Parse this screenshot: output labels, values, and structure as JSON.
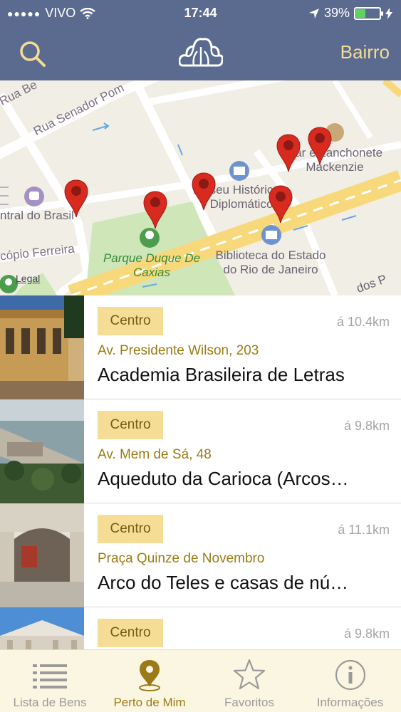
{
  "status_bar": {
    "carrier": "VIVO",
    "time": "17:44",
    "battery": "39%"
  },
  "nav": {
    "right_button": "Bairro",
    "left_icon": "search-icon",
    "center_icon": "cloud-logo-icon"
  },
  "map": {
    "labels": {
      "street1": "Rua Senador Pom",
      "street2": "Rua Be",
      "street3": "cópio Ferreira",
      "station": "ntral do Brasil",
      "museum": "Museu Histórico e Diplomático",
      "cafe": "Bar e Lanchonete Mackenzie",
      "park": "Parque Duque De Caxias",
      "library": "Biblioteca do Estado do Rio de Janeiro",
      "edge": "dos P"
    },
    "legal": "Legal"
  },
  "colors": {
    "header": "#5b6a8f",
    "badge_bg": "#f6dd95",
    "accent": "#9b7a18",
    "pin": "#d92a20"
  },
  "items": [
    {
      "badge": "Centro",
      "distance": "á 10.4km",
      "address": "Av. Presidente Wilson, 203",
      "title": "Academia Brasileira de Letras"
    },
    {
      "badge": "Centro",
      "distance": "á 9.8km",
      "address": "Av. Mem de Sá, 48",
      "title": "Aqueduto da Carioca (Arcos…"
    },
    {
      "badge": "Centro",
      "distance": "á 11.1km",
      "address": "Praça Quinze de Novembro",
      "title": "Arco do Teles e casas de nú…"
    },
    {
      "badge": "Centro",
      "distance": "á 9.8km",
      "address": "",
      "title": ""
    }
  ],
  "tabs": [
    {
      "label": "Lista de Bens",
      "icon": "list-icon",
      "active": false
    },
    {
      "label": "Perto de Mim",
      "icon": "location-pin-icon",
      "active": true
    },
    {
      "label": "Favoritos",
      "icon": "star-icon",
      "active": false
    },
    {
      "label": "Informações",
      "icon": "info-icon",
      "active": false
    }
  ]
}
